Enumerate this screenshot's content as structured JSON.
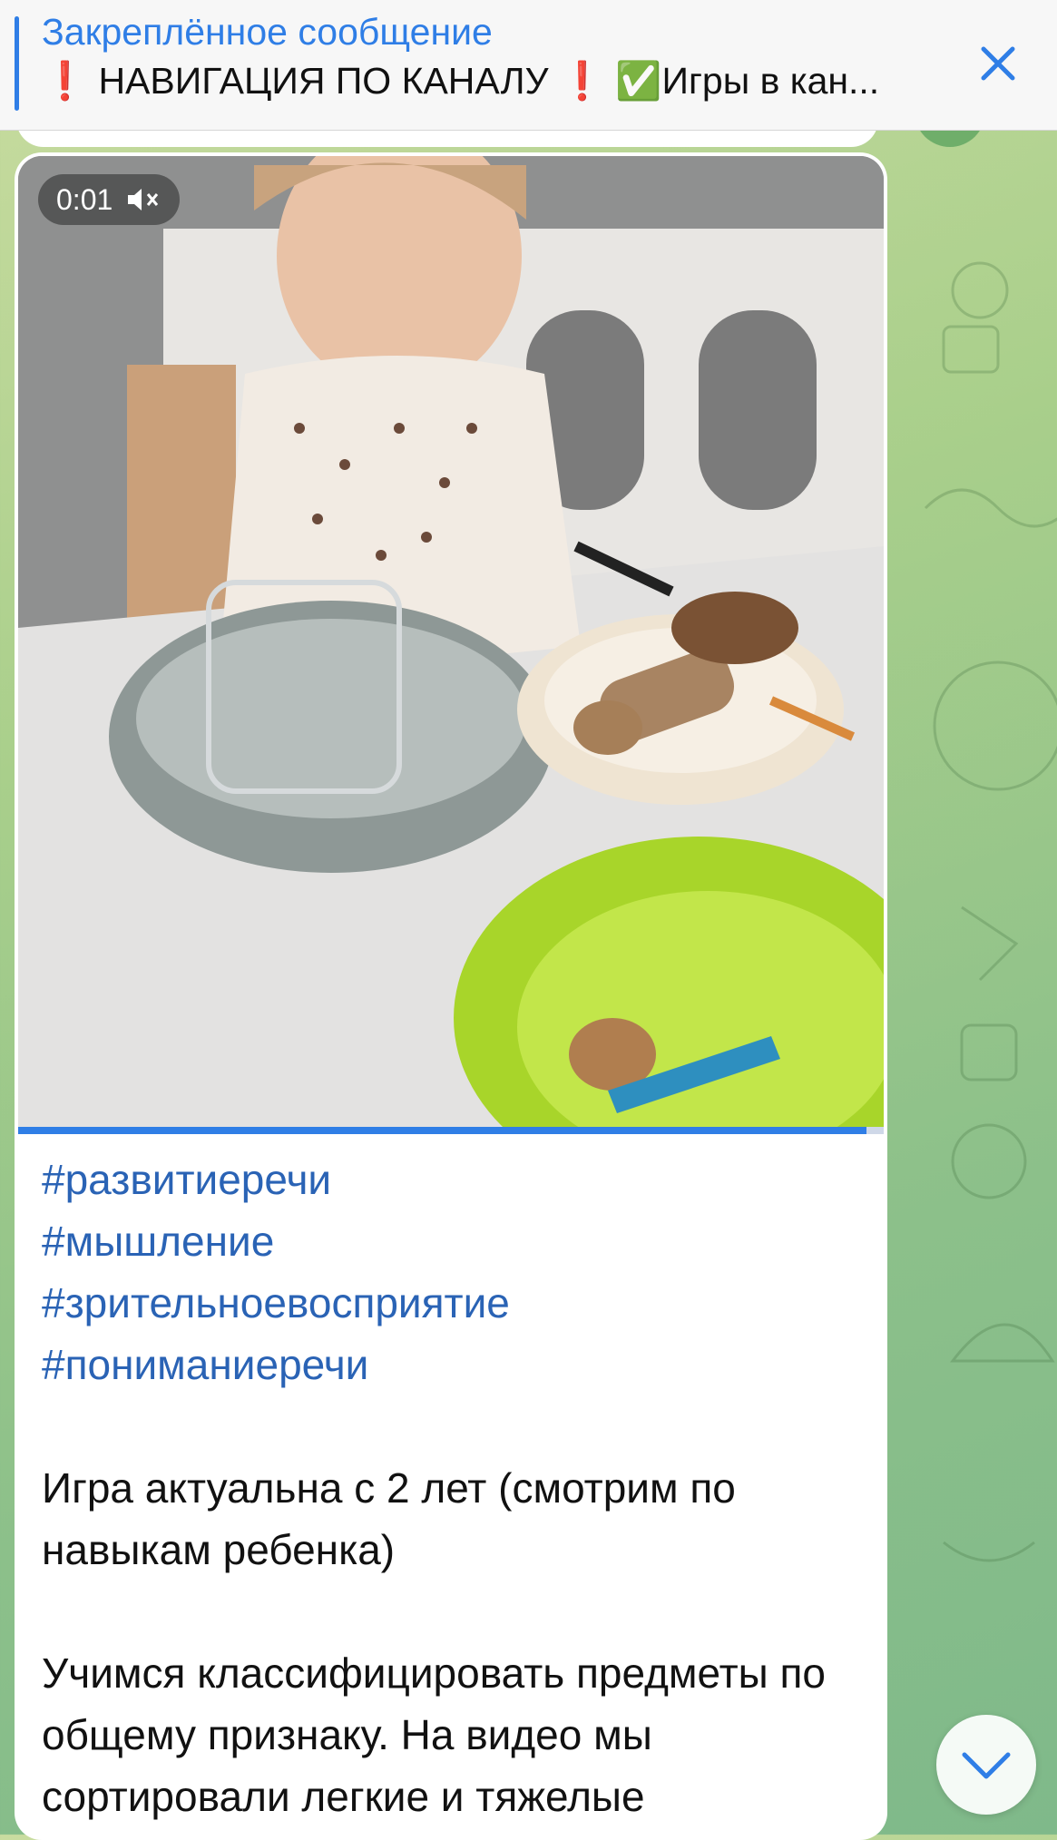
{
  "pinned": {
    "title": "Закреплённое сообщение",
    "text": "❗️ НАВИГАЦИЯ ПО КАНАЛУ ❗️  ✅Игры в кан..."
  },
  "message": {
    "video": {
      "duration": "0:01",
      "progress": 0.98,
      "muted": true
    },
    "hashtags": [
      "#развитиеречи",
      "#мышление",
      "#зрительноевосприятие",
      "#пониманиеречи"
    ],
    "paragraph1": "Игра актуальна с 2 лет (смотрим по навыкам ребенка)",
    "paragraph2": "Учимся классифицировать предметы по общему признаку. На видео мы сортировали легкие и тяжелые"
  },
  "colors": {
    "accent": "#2f7ee6",
    "hashtag": "#2a63b5"
  },
  "icons": {
    "close": "close-icon",
    "mute": "muted-speaker-icon",
    "scroll": "chevron-down-icon"
  }
}
